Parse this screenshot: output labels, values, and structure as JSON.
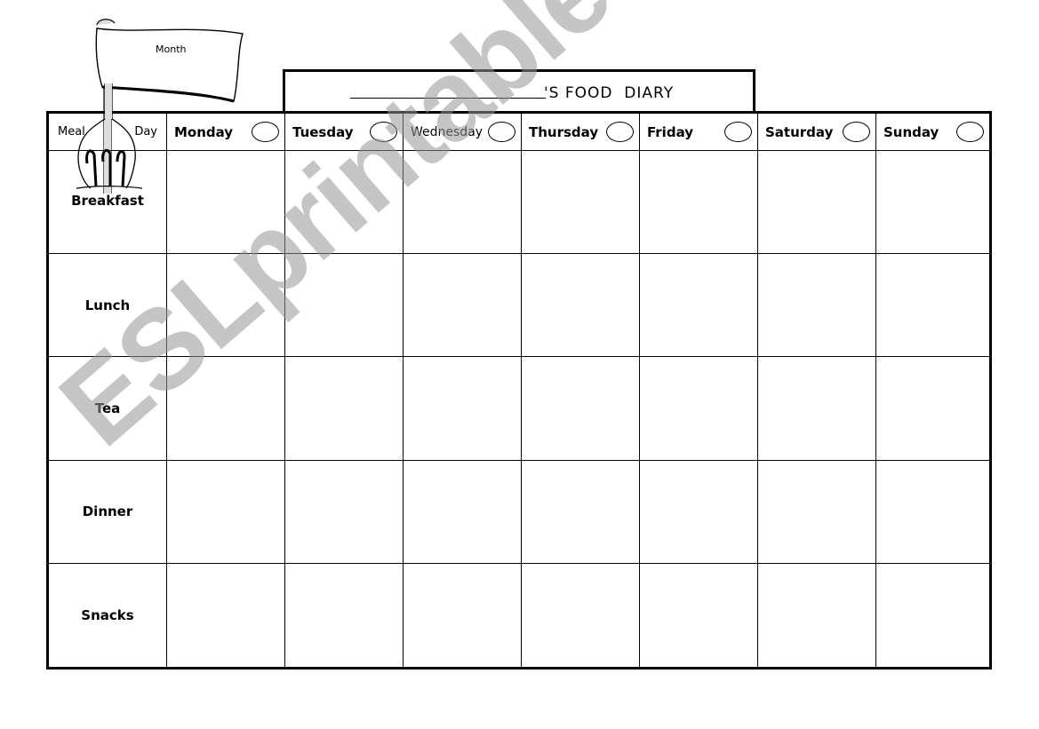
{
  "document": {
    "title_suffix": "'S FOOD  DIARY",
    "flag_label": "Month",
    "watermark": "ESLprintables.com"
  },
  "grid": {
    "corner": {
      "meal_label": "Meal",
      "day_label": "Day"
    },
    "days": [
      "Monday",
      "Tuesday",
      "Wednesday",
      "Thursday",
      "Friday",
      "Saturday",
      "Sunday"
    ],
    "meals": [
      "Breakfast",
      "Lunch",
      "Tea",
      "Dinner",
      "Snacks"
    ]
  }
}
